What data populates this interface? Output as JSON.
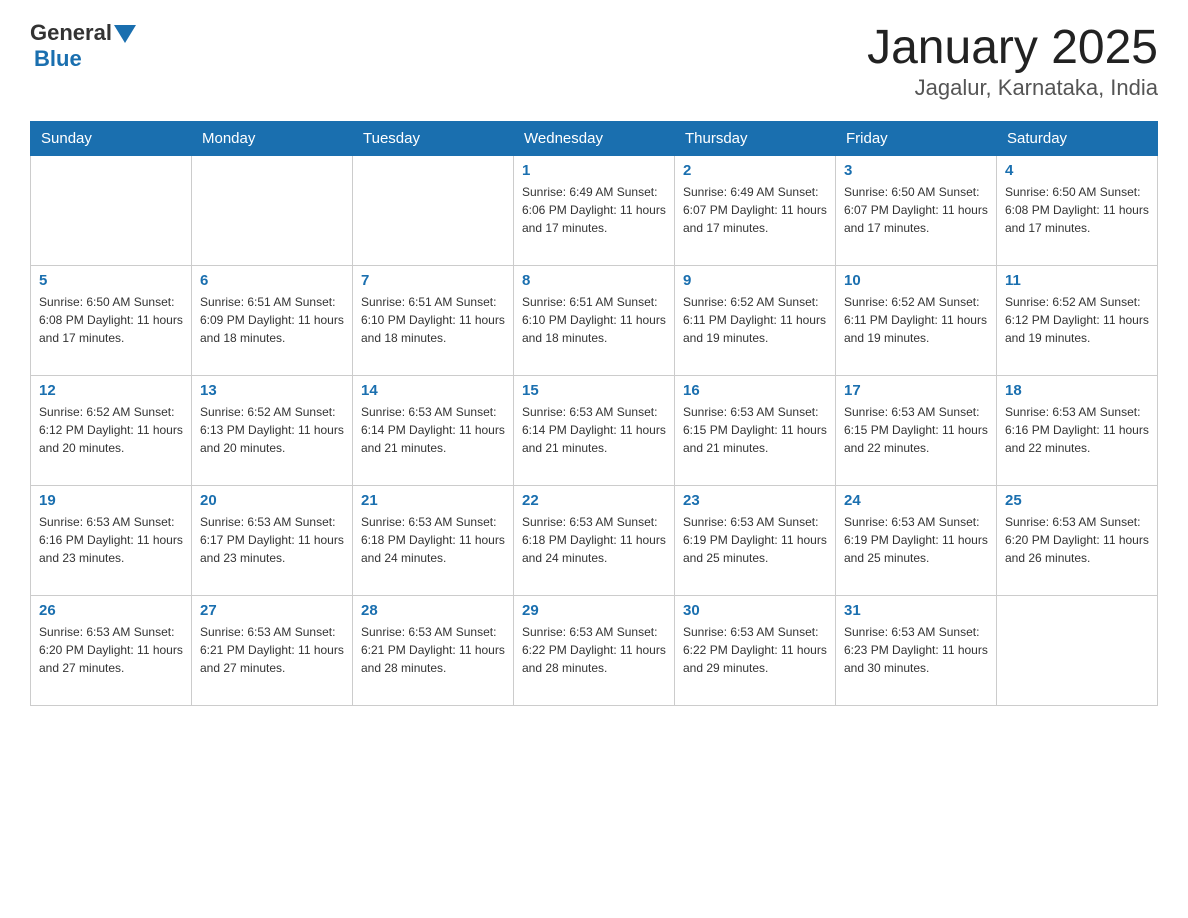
{
  "header": {
    "logo_general": "General",
    "logo_blue": "Blue",
    "title": "January 2025",
    "subtitle": "Jagalur, Karnataka, India"
  },
  "days_of_week": [
    "Sunday",
    "Monday",
    "Tuesday",
    "Wednesday",
    "Thursday",
    "Friday",
    "Saturday"
  ],
  "weeks": [
    [
      {
        "day": "",
        "info": ""
      },
      {
        "day": "",
        "info": ""
      },
      {
        "day": "",
        "info": ""
      },
      {
        "day": "1",
        "info": "Sunrise: 6:49 AM\nSunset: 6:06 PM\nDaylight: 11 hours\nand 17 minutes."
      },
      {
        "day": "2",
        "info": "Sunrise: 6:49 AM\nSunset: 6:07 PM\nDaylight: 11 hours\nand 17 minutes."
      },
      {
        "day": "3",
        "info": "Sunrise: 6:50 AM\nSunset: 6:07 PM\nDaylight: 11 hours\nand 17 minutes."
      },
      {
        "day": "4",
        "info": "Sunrise: 6:50 AM\nSunset: 6:08 PM\nDaylight: 11 hours\nand 17 minutes."
      }
    ],
    [
      {
        "day": "5",
        "info": "Sunrise: 6:50 AM\nSunset: 6:08 PM\nDaylight: 11 hours\nand 17 minutes."
      },
      {
        "day": "6",
        "info": "Sunrise: 6:51 AM\nSunset: 6:09 PM\nDaylight: 11 hours\nand 18 minutes."
      },
      {
        "day": "7",
        "info": "Sunrise: 6:51 AM\nSunset: 6:10 PM\nDaylight: 11 hours\nand 18 minutes."
      },
      {
        "day": "8",
        "info": "Sunrise: 6:51 AM\nSunset: 6:10 PM\nDaylight: 11 hours\nand 18 minutes."
      },
      {
        "day": "9",
        "info": "Sunrise: 6:52 AM\nSunset: 6:11 PM\nDaylight: 11 hours\nand 19 minutes."
      },
      {
        "day": "10",
        "info": "Sunrise: 6:52 AM\nSunset: 6:11 PM\nDaylight: 11 hours\nand 19 minutes."
      },
      {
        "day": "11",
        "info": "Sunrise: 6:52 AM\nSunset: 6:12 PM\nDaylight: 11 hours\nand 19 minutes."
      }
    ],
    [
      {
        "day": "12",
        "info": "Sunrise: 6:52 AM\nSunset: 6:12 PM\nDaylight: 11 hours\nand 20 minutes."
      },
      {
        "day": "13",
        "info": "Sunrise: 6:52 AM\nSunset: 6:13 PM\nDaylight: 11 hours\nand 20 minutes."
      },
      {
        "day": "14",
        "info": "Sunrise: 6:53 AM\nSunset: 6:14 PM\nDaylight: 11 hours\nand 21 minutes."
      },
      {
        "day": "15",
        "info": "Sunrise: 6:53 AM\nSunset: 6:14 PM\nDaylight: 11 hours\nand 21 minutes."
      },
      {
        "day": "16",
        "info": "Sunrise: 6:53 AM\nSunset: 6:15 PM\nDaylight: 11 hours\nand 21 minutes."
      },
      {
        "day": "17",
        "info": "Sunrise: 6:53 AM\nSunset: 6:15 PM\nDaylight: 11 hours\nand 22 minutes."
      },
      {
        "day": "18",
        "info": "Sunrise: 6:53 AM\nSunset: 6:16 PM\nDaylight: 11 hours\nand 22 minutes."
      }
    ],
    [
      {
        "day": "19",
        "info": "Sunrise: 6:53 AM\nSunset: 6:16 PM\nDaylight: 11 hours\nand 23 minutes."
      },
      {
        "day": "20",
        "info": "Sunrise: 6:53 AM\nSunset: 6:17 PM\nDaylight: 11 hours\nand 23 minutes."
      },
      {
        "day": "21",
        "info": "Sunrise: 6:53 AM\nSunset: 6:18 PM\nDaylight: 11 hours\nand 24 minutes."
      },
      {
        "day": "22",
        "info": "Sunrise: 6:53 AM\nSunset: 6:18 PM\nDaylight: 11 hours\nand 24 minutes."
      },
      {
        "day": "23",
        "info": "Sunrise: 6:53 AM\nSunset: 6:19 PM\nDaylight: 11 hours\nand 25 minutes."
      },
      {
        "day": "24",
        "info": "Sunrise: 6:53 AM\nSunset: 6:19 PM\nDaylight: 11 hours\nand 25 minutes."
      },
      {
        "day": "25",
        "info": "Sunrise: 6:53 AM\nSunset: 6:20 PM\nDaylight: 11 hours\nand 26 minutes."
      }
    ],
    [
      {
        "day": "26",
        "info": "Sunrise: 6:53 AM\nSunset: 6:20 PM\nDaylight: 11 hours\nand 27 minutes."
      },
      {
        "day": "27",
        "info": "Sunrise: 6:53 AM\nSunset: 6:21 PM\nDaylight: 11 hours\nand 27 minutes."
      },
      {
        "day": "28",
        "info": "Sunrise: 6:53 AM\nSunset: 6:21 PM\nDaylight: 11 hours\nand 28 minutes."
      },
      {
        "day": "29",
        "info": "Sunrise: 6:53 AM\nSunset: 6:22 PM\nDaylight: 11 hours\nand 28 minutes."
      },
      {
        "day": "30",
        "info": "Sunrise: 6:53 AM\nSunset: 6:22 PM\nDaylight: 11 hours\nand 29 minutes."
      },
      {
        "day": "31",
        "info": "Sunrise: 6:53 AM\nSunset: 6:23 PM\nDaylight: 11 hours\nand 30 minutes."
      },
      {
        "day": "",
        "info": ""
      }
    ]
  ]
}
